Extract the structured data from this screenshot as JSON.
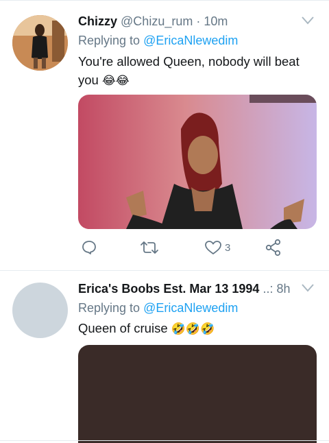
{
  "tweets": [
    {
      "name": "Chizzy",
      "handle": "@Chizu_rum",
      "separator": "·",
      "time": "10m",
      "replying_prefix": "Replying to",
      "replying_to": "@EricaNlewedim",
      "text": "You're allowed Queen, nobody will beat you",
      "emojis": "😂😂",
      "actions": {
        "like_count": "3"
      }
    },
    {
      "name": "Erica's Boobs Est. Mar 13 1994",
      "separator": "..:",
      "time": "8h",
      "replying_prefix": "Replying to",
      "replying_to": "@EricaNlewedim",
      "text": "Queen of cruise",
      "emojis": "🤣🤣🤣"
    }
  ],
  "colors": {
    "accent": "#1da1f2",
    "secondary_text": "#657786",
    "divider": "#e6ecf0"
  },
  "icons": [
    "chevron-down-icon",
    "reply-icon",
    "retweet-icon",
    "heart-icon",
    "share-icon"
  ]
}
